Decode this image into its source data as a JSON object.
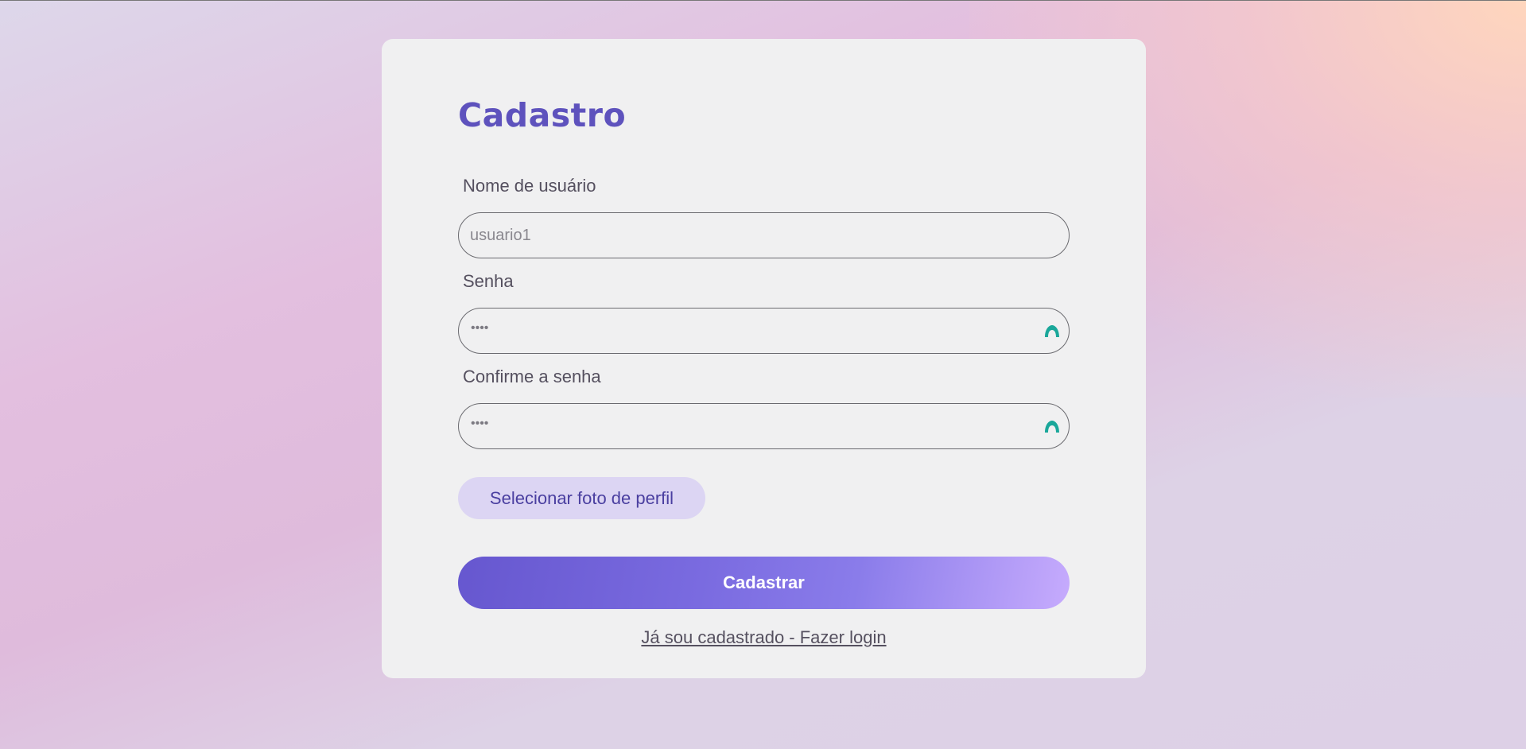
{
  "form": {
    "title": "Cadastro",
    "username": {
      "label": "Nome de usuário",
      "placeholder": "usuario1"
    },
    "password": {
      "label": "Senha",
      "masked_value": "••••",
      "toggle_icon": "eye-toggle-icon"
    },
    "confirm_password": {
      "label": "Confirme a senha",
      "masked_value": "••••",
      "toggle_icon": "eye-toggle-icon"
    },
    "photo_button_label": "Selecionar foto de perfil",
    "submit_label": "Cadastrar",
    "login_link": "Já sou cadastrado - Fazer login"
  },
  "colors": {
    "accent": "#5e52bd",
    "eye_icon": "#1aa79a",
    "photo_button_bg": "#dcd5f3"
  }
}
